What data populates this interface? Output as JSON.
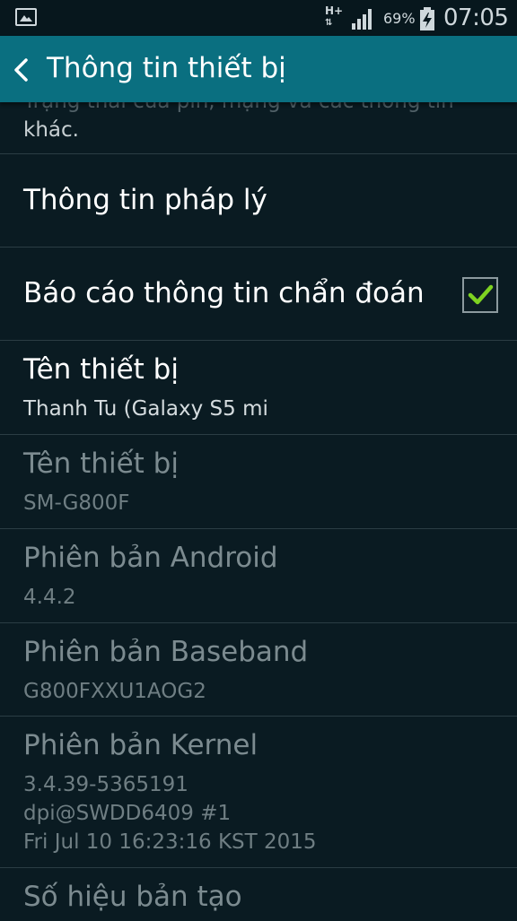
{
  "status_bar": {
    "network_type": "H+",
    "network_arrows": "⇅",
    "battery_percent": "69%",
    "time": "07:05",
    "icons": [
      "gallery-icon",
      "signal-icon",
      "battery-charging-icon"
    ]
  },
  "action_bar": {
    "back_icon": "back-arrow-icon",
    "title": "Thông tin thiết bị"
  },
  "list": {
    "peek_line_1": "Trạng thái của pin, mạng và các thông tin",
    "peek_line_2": "khác.",
    "items": [
      {
        "title": "Thông tin pháp lý"
      },
      {
        "title": "Báo cáo thông tin chẩn đoán",
        "checked": true
      },
      {
        "title": "Tên thiết bị",
        "subtitle": "Thanh Tu (Galaxy S5 mi"
      },
      {
        "title": "Tên thiết bị",
        "subtitle": "SM-G800F"
      },
      {
        "title": "Phiên bản Android",
        "subtitle": "4.4.2"
      },
      {
        "title": "Phiên bản Baseband",
        "subtitle": "G800FXXU1AOG2"
      },
      {
        "title": "Phiên bản Kernel",
        "subtitle": "3.4.39-5365191\ndpi@SWDD6409 #1\nFri Jul 10 16:23:16 KST 2015"
      },
      {
        "title": "Số hiệu bản tạo"
      }
    ]
  },
  "colors": {
    "background": "#0a1b22",
    "action_bar": "#0a6f80",
    "checkmark": "#7ed321",
    "divider": "#2b3d44"
  }
}
